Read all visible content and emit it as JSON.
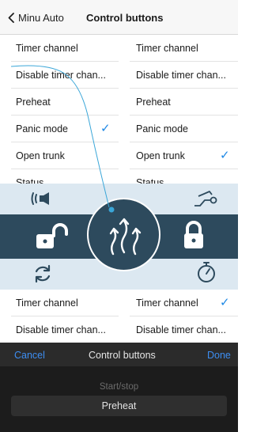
{
  "nav": {
    "back_label": "Minu Auto",
    "title": "Control buttons"
  },
  "list_top": [
    {
      "left": "Timer channel",
      "right": "Timer channel",
      "left_checked": false,
      "right_checked": false
    },
    {
      "left": "Disable timer chan...",
      "right": "Disable timer chan...",
      "left_checked": false,
      "right_checked": false
    },
    {
      "left": "Preheat",
      "right": "Preheat",
      "left_checked": false,
      "right_checked": false
    },
    {
      "left": "Panic mode",
      "right": "Panic mode",
      "left_checked": true,
      "right_checked": false
    },
    {
      "left": "Open trunk",
      "right": "Open trunk",
      "left_checked": false,
      "right_checked": true
    },
    {
      "left": "Status",
      "right": "Status",
      "left_checked": false,
      "right_checked": false
    }
  ],
  "list_bottom": [
    {
      "left": "Timer channel",
      "right": "Timer channel",
      "left_checked": false,
      "right_checked": true
    },
    {
      "left": "Disable timer chan...",
      "right": "Disable timer chan...",
      "left_checked": false,
      "right_checked": false
    }
  ],
  "control_panel": {
    "icons": [
      "horn-icon",
      "trunk-icon",
      "unlock-icon",
      "lock-icon",
      "restart-icon",
      "timer-icon",
      "heat-waves-icon"
    ],
    "colors": {
      "band": "#2d4a5d",
      "wedge": "#dce8f1",
      "check": "#1e88e5"
    }
  },
  "bottom_sheet": {
    "cancel_label": "Cancel",
    "title": "Control buttons",
    "done_label": "Done",
    "picker_options": [
      "Start/stop",
      "Preheat"
    ],
    "picker_selected": "Preheat"
  }
}
